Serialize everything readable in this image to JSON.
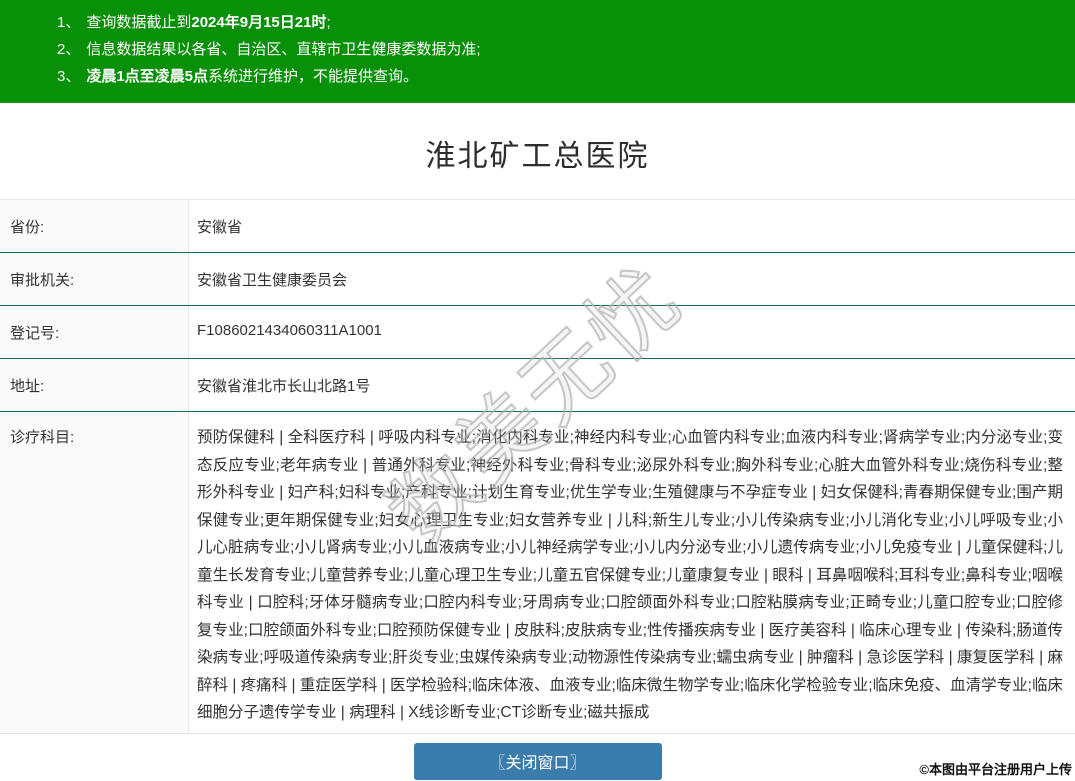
{
  "notice_bar": {
    "bg_color": "#089008",
    "items": [
      {
        "num": "1、",
        "pre": "查询数据截止到",
        "bold": "2024年9月15日21时",
        "post": ";"
      },
      {
        "num": "2、",
        "pre": "信息数据结果以各省、自治区、直辖市卫生健康委数据为准;",
        "bold": "",
        "post": ""
      },
      {
        "num": "3、",
        "pre": "",
        "bold": "凌晨1点至凌晨5点",
        "post": "系统进行维护，不能提供查询。"
      }
    ]
  },
  "title": "淮北矿工总医院",
  "info_table": {
    "separator_color": "#11704a",
    "rows": [
      {
        "label": "省份:",
        "value": "安徽省"
      },
      {
        "label": "审批机关:",
        "value": "安徽省卫生健康委员会"
      },
      {
        "label": "登记号:",
        "value": "F1086021434060311A1001"
      },
      {
        "label": "地址:",
        "value": "安徽省淮北市长山北路1号"
      },
      {
        "label": "诊疗科目:",
        "value": "预防保健科 | 全科医疗科 | 呼吸内科专业;消化内科专业;神经内科专业;心血管内科专业;血液内科专业;肾病学专业;内分泌专业;变态反应专业;老年病专业 | 普通外科专业;神经外科专业;骨科专业;泌尿外科专业;胸外科专业;心脏大血管外科专业;烧伤科专业;整形外科专业 | 妇产科;妇科专业;产科专业;计划生育专业;优生学专业;生殖健康与不孕症专业 | 妇女保健科;青春期保健专业;围产期保健专业;更年期保健专业;妇女心理卫生专业;妇女营养专业 | 儿科;新生儿专业;小儿传染病专业;小儿消化专业;小儿呼吸专业;小儿心脏病专业;小儿肾病专业;小儿血液病专业;小儿神经病学专业;小儿内分泌专业;小儿遗传病专业;小儿免疫专业 | 儿童保健科;儿童生长发育专业;儿童营养专业;儿童心理卫生专业;儿童五官保健专业;儿童康复专业 | 眼科 | 耳鼻咽喉科;耳科专业;鼻科专业;咽喉科专业 | 口腔科;牙体牙髓病专业;口腔内科专业;牙周病专业;口腔颌面外科专业;口腔粘膜病专业;正畸专业;儿童口腔专业;口腔修复专业;口腔颌面外科专业;口腔预防保健专业 | 皮肤科;皮肤病专业;性传播疾病专业 | 医疗美容科 | 临床心理专业 | 传染科;肠道传染病专业;呼吸道传染病专业;肝炎专业;虫媒传染病专业;动物源性传染病专业;蠕虫病专业 | 肿瘤科 | 急诊医学科 | 康复医学科 | 麻醉科 | 疼痛科 | 重症医学科 | 医学检验科;临床体液、血液专业;临床微生物学专业;临床化学检验专业;临床免疫、血清学专业;临床细胞分子遗传学专业 | 病理科 | X线诊断专业;CT诊断专业;磁共振成"
      }
    ]
  },
  "close_button": {
    "label": "〖关闭窗口〗",
    "bg_color": "#3a7dad"
  },
  "watermark": {
    "text": "数美无忧"
  },
  "footer": {
    "copyright": "©本图由平台注册用户上传"
  }
}
